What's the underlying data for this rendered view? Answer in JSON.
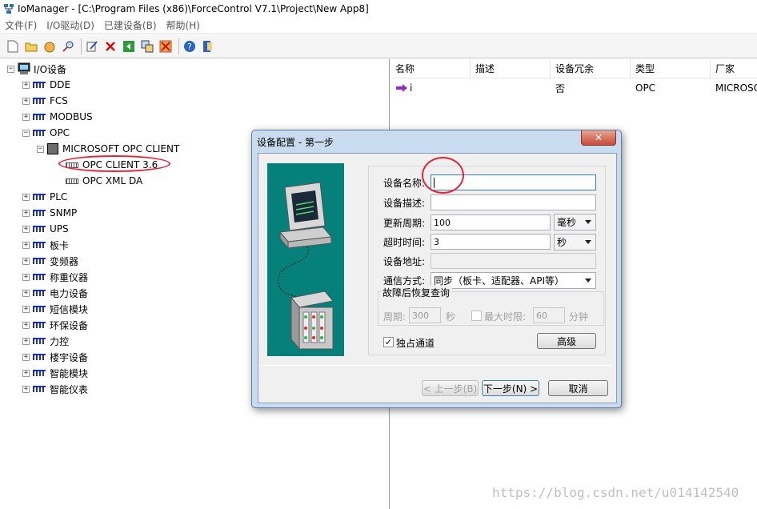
{
  "window": {
    "title": "IoManager - [C:\\Program Files (x86)\\ForceControl V7.1\\Project\\New App8]"
  },
  "menu": [
    "文件(F)",
    "I/O驱动(D)",
    "已建设备(B)",
    "帮助(H)"
  ],
  "toolbar": {
    "icons": [
      "new-icon",
      "open-icon",
      "hand-icon",
      "find-icon",
      "edit-icon",
      "delete-icon",
      "back-icon",
      "copy-icon",
      "cut-icon",
      "help-icon",
      "exit-icon"
    ]
  },
  "tree": {
    "root": "I/O设备",
    "items": [
      "DDE",
      "FCS",
      "MODBUS",
      "OPC"
    ],
    "opc_children": {
      "vendor": "MICROSOFT OPC CLIENT",
      "drivers": [
        "OPC CLIENT 3.6",
        "OPC XML DA"
      ]
    },
    "rest": [
      "PLC",
      "SNMP",
      "UPS",
      "板卡",
      "变频器",
      "称重仪器",
      "电力设备",
      "短信模块",
      "环保设备",
      "力控",
      "楼宇设备",
      "智能模块",
      "智能仪表"
    ]
  },
  "list": {
    "columns": [
      "名称",
      "描述",
      "设备冗余",
      "类型",
      "厂家"
    ],
    "rows": [
      {
        "name": "i",
        "desc": "",
        "redundant": "否",
        "type": "OPC",
        "vendor": "MICROSO"
      }
    ]
  },
  "dialog": {
    "title": "设备配置 - 第一步",
    "close": "✕",
    "fields": {
      "device_name": {
        "label": "设备名称:",
        "value": ""
      },
      "device_desc": {
        "label": "设备描述:",
        "value": ""
      },
      "update_period": {
        "label": "更新周期:",
        "value": "100",
        "unit": "毫秒"
      },
      "timeout": {
        "label": "超时时间:",
        "value": "3",
        "unit": "秒"
      },
      "address": {
        "label": "设备地址:",
        "value": ""
      },
      "comm_mode": {
        "label": "通信方式:",
        "value": "同步（板卡、适配器、API等）"
      }
    },
    "recovery": {
      "group_label": "故障后恢复查询",
      "period_label": "周期:",
      "period_value": "300",
      "period_unit": "秒",
      "max_time_label": "最大时限:",
      "max_time_value": "60",
      "max_time_unit": "分钟"
    },
    "exclusive": {
      "label": "独占通道",
      "checked": true
    },
    "advanced_button": "高级",
    "buttons": {
      "prev": "< 上一步(B)",
      "next": "下一步(N) >",
      "cancel": "取消"
    }
  },
  "watermark": "https://blog.csdn.net/u014142540",
  "colors": {
    "dialog_frame": "#c9dbee",
    "illustration_bg": "#05807a",
    "highlight_circle": "#e0253a"
  }
}
